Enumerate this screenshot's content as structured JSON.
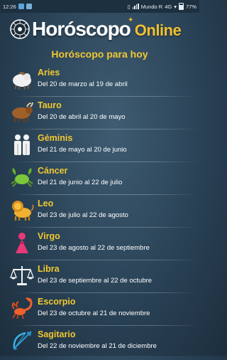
{
  "status_bar": {
    "time": "12:26",
    "carrier": "Mundo R",
    "network": "4G",
    "battery": "77%"
  },
  "logo": {
    "main": "Horóscopo",
    "secondary": "Online"
  },
  "heading": "Horóscopo para hoy",
  "signs": [
    {
      "name": "Aries",
      "dates": "Del 20 de marzo al 19 de abril",
      "icon": "ram-icon"
    },
    {
      "name": "Tauro",
      "dates": "Del 20 de abril al 20 de mayo",
      "icon": "bull-icon"
    },
    {
      "name": "Géminis",
      "dates": "Del 21 de mayo al 20 de junio",
      "icon": "twins-icon"
    },
    {
      "name": "Cáncer",
      "dates": "Del 21 de junio al 22 de julio",
      "icon": "crab-icon"
    },
    {
      "name": "Leo",
      "dates": "Del 23 de julio al 22 de agosto",
      "icon": "lion-icon"
    },
    {
      "name": "Virgo",
      "dates": "Del 23 de agosto al 22 de septiembre",
      "icon": "maiden-icon"
    },
    {
      "name": "Libra",
      "dates": "Del 23 de septiembre al 22 de octubre",
      "icon": "scales-icon"
    },
    {
      "name": "Escorpio",
      "dates": "Del 23 de octubre al 21 de noviembre",
      "icon": "scorpion-icon"
    },
    {
      "name": "Sagitario",
      "dates": "Del 22 de noviembre al 21 de diciembre",
      "icon": "archer-icon"
    }
  ],
  "colors": {
    "accent": "#f0c830",
    "background": "#2a4256",
    "status_bar": "#1d3040"
  }
}
